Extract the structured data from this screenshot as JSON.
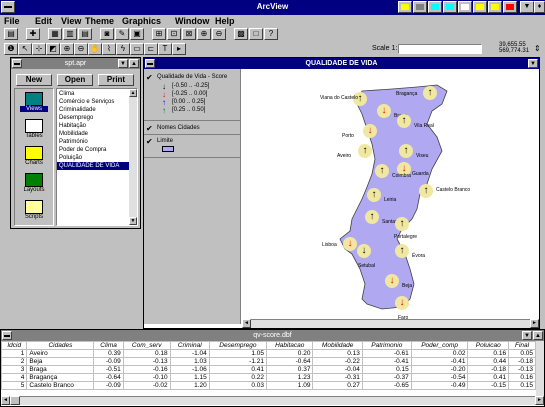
{
  "app": {
    "title": "ArcView",
    "menus": [
      "File",
      "Edit",
      "View",
      "Theme",
      "Graphics",
      "Window",
      "Help"
    ]
  },
  "toolbar": {
    "scale_label": "Scale 1:",
    "scale_value": "",
    "coord_x": "39,655.55",
    "coord_y": "569,774.31"
  },
  "project": {
    "title": "spt.apr",
    "new_label": "New",
    "open_label": "Open",
    "print_label": "Print",
    "doc_types": [
      "Views",
      "Tables",
      "Charts",
      "Layouts",
      "Scripts"
    ],
    "selected_type": "Views",
    "views": [
      "Clima",
      "Comércio e Serviços",
      "Criminalidade",
      "Desemprego",
      "Habitação",
      "Mobilidade",
      "Património",
      "Poder de Compra",
      "Poluição",
      "QUALIDADE DE VIDA"
    ],
    "selected_view": "QUALIDADE DE VIDA"
  },
  "map": {
    "title": "QUALIDADE DE VIDA",
    "legend": {
      "theme1_title": "Qualidade de Vida - Score",
      "classes": [
        {
          "label": "[-0.50 .. -0.25]",
          "color": "#000000",
          "dir": "down"
        },
        {
          "label": "[-0.25 .. 0.00]",
          "color": "#ff0000",
          "dir": "down"
        },
        {
          "label": "[0.00 .. 0.25]",
          "color": "#0000ff",
          "dir": "up"
        },
        {
          "label": "[0.25 .. 0.50]",
          "color": "#008000",
          "dir": "up"
        }
      ],
      "theme2_title": "Nomes Cidades",
      "theme3_title": "Limite",
      "limit_color": "#b0a8f0"
    },
    "cities": [
      {
        "name": "Viana do Castelo",
        "dir": "up",
        "color": "#000000"
      },
      {
        "name": "Braga",
        "dir": "down",
        "color": "#ff0000"
      },
      {
        "name": "Vila Real",
        "dir": "up",
        "color": "#000000"
      },
      {
        "name": "Bragança",
        "dir": "up",
        "color": "#000000"
      },
      {
        "name": "Porto",
        "dir": "down",
        "color": "#ff0000"
      },
      {
        "name": "Aveiro",
        "dir": "up",
        "color": "#000000"
      },
      {
        "name": "Viseu",
        "dir": "up",
        "color": "#000000"
      },
      {
        "name": "Guarda",
        "dir": "down",
        "color": "#ff0000"
      },
      {
        "name": "Coimbra",
        "dir": "up",
        "color": "#000000"
      },
      {
        "name": "Leiria",
        "dir": "up",
        "color": "#000000"
      },
      {
        "name": "Castelo Branco",
        "dir": "up",
        "color": "#000000"
      },
      {
        "name": "Santarem",
        "dir": "up",
        "color": "#000000"
      },
      {
        "name": "Portalegre",
        "dir": "up",
        "color": "#000000"
      },
      {
        "name": "Lisboa",
        "dir": "down",
        "color": "#ff0000"
      },
      {
        "name": "Setubal",
        "dir": "down",
        "color": "#000000"
      },
      {
        "name": "Évora",
        "dir": "up",
        "color": "#000000"
      },
      {
        "name": "Beja",
        "dir": "down",
        "color": "#ff0000"
      },
      {
        "name": "Faro",
        "dir": "down",
        "color": "#ff0000"
      }
    ],
    "fill_color": "#b0a8f0",
    "marker_color": "#f0e8a0"
  },
  "table": {
    "title": "qv-score.dbf",
    "columns": [
      "Idcid",
      "Cidades",
      "Clima",
      "Com_serv",
      "Criminal",
      "Desemprego",
      "Habitacao",
      "Mobilidade",
      "Patrimonio",
      "Poder_comp",
      "Poluicao",
      "Final"
    ],
    "rows": [
      [
        "1",
        "Aveiro",
        "0.39",
        "0.18",
        "-1.04",
        "1.05",
        "0.20",
        "0.13",
        "-0.61",
        "0.02",
        "0.16",
        "0.05"
      ],
      [
        "2",
        "Beja",
        "-0.09",
        "-0.13",
        "1.03",
        "-1.21",
        "-0.64",
        "-0.22",
        "-0.41",
        "-0.41",
        "0.44",
        "-0.18"
      ],
      [
        "3",
        "Braga",
        "-0.51",
        "-0.16",
        "-1.06",
        "0.41",
        "0.37",
        "-0.04",
        "0.15",
        "-0.20",
        "-0.18",
        "-0.13"
      ],
      [
        "4",
        "Bragança",
        "-0.64",
        "-0.10",
        "1.15",
        "0.22",
        "1.23",
        "-0.31",
        "-0.37",
        "-0.54",
        "0.41",
        "0.16"
      ],
      [
        "5",
        "Castelo Branco",
        "-0.09",
        "-0.02",
        "1.20",
        "0.03",
        "1.09",
        "0.27",
        "-0.65",
        "-0.49",
        "-0.15",
        "0.15"
      ]
    ]
  }
}
